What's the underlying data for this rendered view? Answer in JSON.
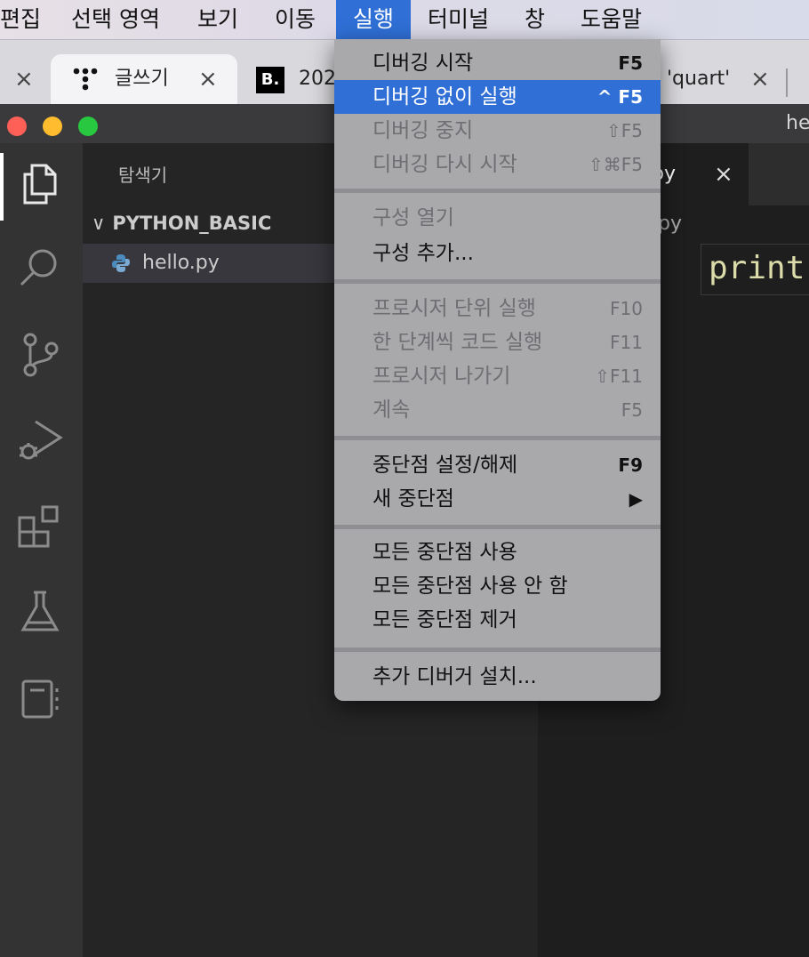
{
  "menubar": {
    "items": [
      "편집",
      "선택 영역",
      "보기",
      "이동",
      "실행",
      "터미널",
      "창",
      "도움말"
    ],
    "active": "실행"
  },
  "browser_tabs": {
    "tab1": {
      "label": "글쓰기",
      "close": "×"
    },
    "tab2": {
      "label": "202",
      "logo": "B."
    },
    "tab3": {
      "label": "'quart'",
      "close": "×"
    },
    "left_close": "×"
  },
  "window": {
    "title": "he"
  },
  "explorer": {
    "title": "탐색기",
    "folder": "PYTHON_BASIC",
    "folder_chevron": "∨",
    "file": "hello.py"
  },
  "editor": {
    "tab_label": "py",
    "tab_close": "×",
    "breadcrumb": "py",
    "code": "print"
  },
  "run_menu": {
    "groups": [
      [
        {
          "label": "디버깅 시작",
          "shortcut": "F5",
          "enabled": true
        },
        {
          "label": "디버깅 없이 실행",
          "shortcut": "^ F5",
          "enabled": true,
          "highlighted": true
        },
        {
          "label": "디버깅 중지",
          "shortcut": "⇧F5",
          "enabled": false
        },
        {
          "label": "디버깅 다시 시작",
          "shortcut": "⇧⌘F5",
          "enabled": false
        }
      ],
      [
        {
          "label": "구성 열기",
          "shortcut": "",
          "enabled": false
        },
        {
          "label": "구성 추가...",
          "shortcut": "",
          "enabled": true
        }
      ],
      [
        {
          "label": "프로시저 단위 실행",
          "shortcut": "F10",
          "enabled": false
        },
        {
          "label": "한 단계씩 코드 실행",
          "shortcut": "F11",
          "enabled": false
        },
        {
          "label": "프로시저 나가기",
          "shortcut": "⇧F11",
          "enabled": false
        },
        {
          "label": "계속",
          "shortcut": "F5",
          "enabled": false
        }
      ],
      [
        {
          "label": "중단점 설정/해제",
          "shortcut": "F9",
          "enabled": true
        },
        {
          "label": "새 중단점",
          "shortcut": "▶",
          "enabled": true
        }
      ],
      [
        {
          "label": "모든 중단점 사용",
          "shortcut": "",
          "enabled": true
        },
        {
          "label": "모든 중단점 사용 안 함",
          "shortcut": "",
          "enabled": true
        },
        {
          "label": "모든 중단점 제거",
          "shortcut": "",
          "enabled": true
        }
      ],
      [
        {
          "label": "추가 디버거 설치...",
          "shortcut": "",
          "enabled": true
        }
      ]
    ]
  },
  "colors": {
    "menu_highlight": "#2f6fd6",
    "traffic_red": "#fe5f57",
    "traffic_yellow": "#febc2e",
    "traffic_green": "#28c840",
    "code_function": "#dcdcaa"
  },
  "activity_icons": [
    "files-icon",
    "search-icon",
    "source-control-icon",
    "run-debug-icon",
    "extensions-icon",
    "testing-icon",
    "notebook-icon"
  ]
}
